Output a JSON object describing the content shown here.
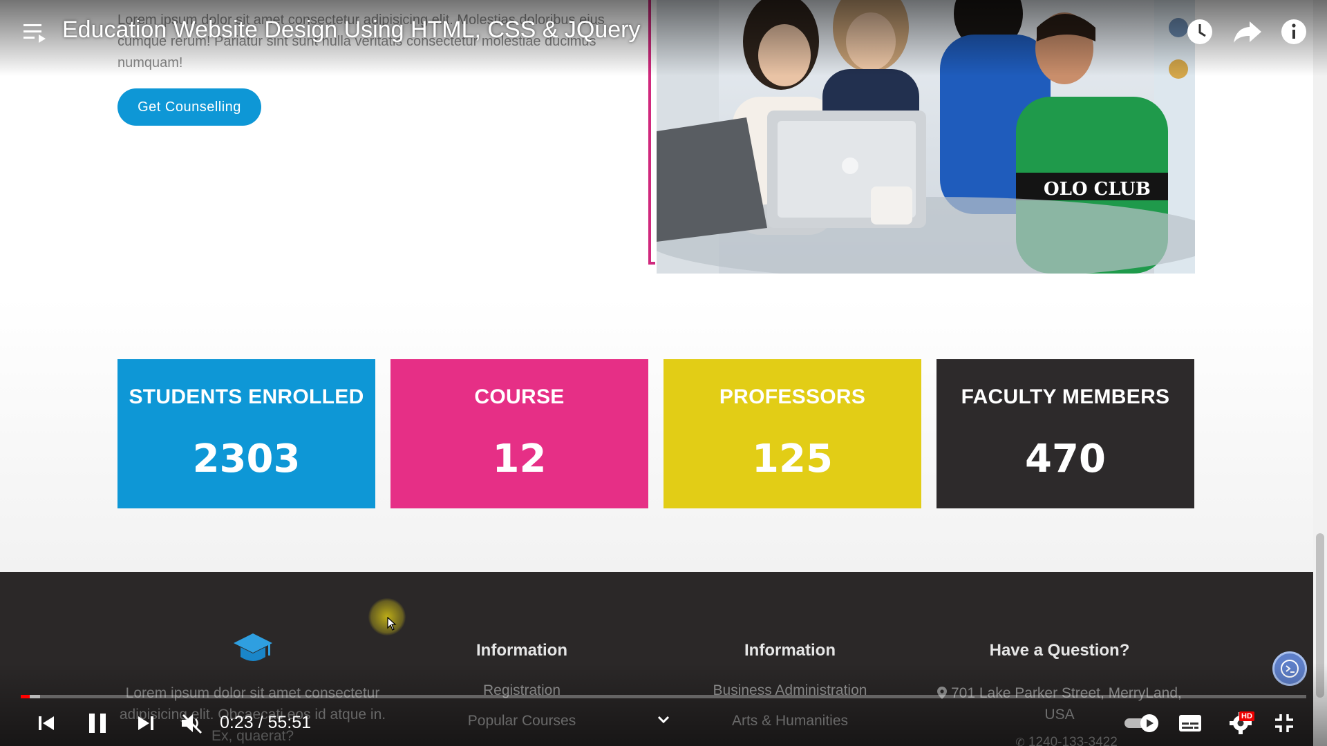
{
  "player": {
    "title": "Education Website Design Using HTML, CSS & JQuery",
    "time_display": "0:23 / 55:51",
    "progress_fraction": 0.0069,
    "buffer_fraction": 0.015,
    "hd_badge": "HD",
    "icons": [
      "playlist-icon",
      "watch-later-icon",
      "share-icon",
      "info-icon",
      "previous-icon",
      "pause-icon",
      "next-icon",
      "muted-volume-icon",
      "chevron-up-icon",
      "autoplay-toggle-icon",
      "subtitles-icon",
      "settings-icon",
      "exit-fullscreen-icon"
    ]
  },
  "about": {
    "text": "Lorem ipsum dolor sit amet consectetur adipisicing elit. Molestias doloribus eius cumque rerum! Pariatur sint sunt nulla veritatis consectetur molestiae ducimus numquam!",
    "button_label": "Get Counselling",
    "accent_color": "#d0297d"
  },
  "stats": [
    {
      "label": "STUDENTS ENROLLED",
      "value": "2303",
      "color": "#0e97d6"
    },
    {
      "label": "COURSE",
      "value": "12",
      "color": "#e62f86"
    },
    {
      "label": "PROFESSORS",
      "value": "125",
      "color": "#e2cd16"
    },
    {
      "label": "FACULTY MEMBERS",
      "value": "470",
      "color": "#2d2a2b"
    }
  ],
  "footer": {
    "logo_icon": "graduation-cap-icon",
    "description": "Lorem ipsum dolor sit amet consectetur adipisicing elit. Obcaecati eos id atque in. Ex, quaerat?",
    "col1_title": "Information",
    "col1_links": [
      "Registration",
      "Popular Courses"
    ],
    "col2_title": "Information",
    "col2_links": [
      "Business Administration",
      "Arts & Humanities"
    ],
    "col3_title": "Have a Question?",
    "address": "701 Lake Parker Street, MerryLand, USA",
    "phone": "1240-133-3422"
  }
}
